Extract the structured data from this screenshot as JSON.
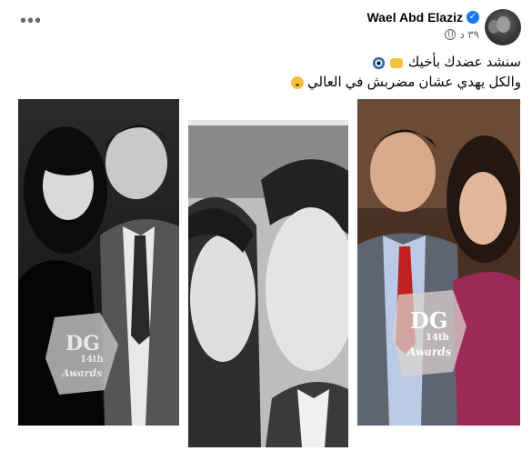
{
  "post": {
    "author": "Wael Abd Elaziz",
    "timestamp": "٣٩ د",
    "line1_text": "سنشد عضدك بأخيك",
    "line2_text": "والكل يهدي عشان مضربش في العالي",
    "more_label": "•••"
  },
  "photos": [
    {
      "award_brand": "DG",
      "award_number": "14th",
      "award_word": "Awards"
    },
    {},
    {
      "award_brand": "DG",
      "award_number": "14th",
      "award_word": "Awards"
    }
  ],
  "colors": {
    "accent": "#1877f2",
    "text": "#050505",
    "secondary_text": "#65676b"
  },
  "icons": [
    "verified-badge-icon",
    "globe-icon",
    "more-options-icon",
    "evil-eye-emoji-icon",
    "fist-emoji-icon",
    "hushed-face-emoji-icon"
  ]
}
